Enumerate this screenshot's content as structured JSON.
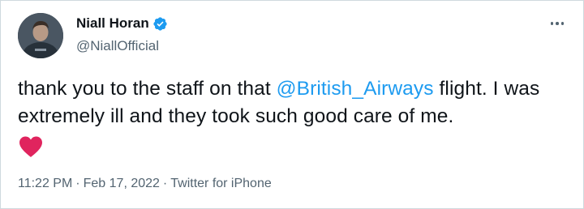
{
  "user": {
    "display_name": "Niall Horan",
    "handle": "@NiallOfficial",
    "verified": true
  },
  "tweet": {
    "text_part1": "thank you to the staff on that ",
    "mention": "@British_Airways",
    "text_part2": " flight. I was extremely ill and they took such good care of me.",
    "emoji": "heart-emoji"
  },
  "meta": {
    "time": "11:22 PM",
    "separator": "·",
    "date": "Feb 17, 2022",
    "source": "Twitter for iPhone"
  },
  "colors": {
    "link": "#1d9bf0",
    "text": "#0f1419",
    "secondary": "#536471",
    "heart": "#f91880"
  },
  "icons": {
    "verified": "verified-badge-icon",
    "more": "more-options-icon"
  }
}
